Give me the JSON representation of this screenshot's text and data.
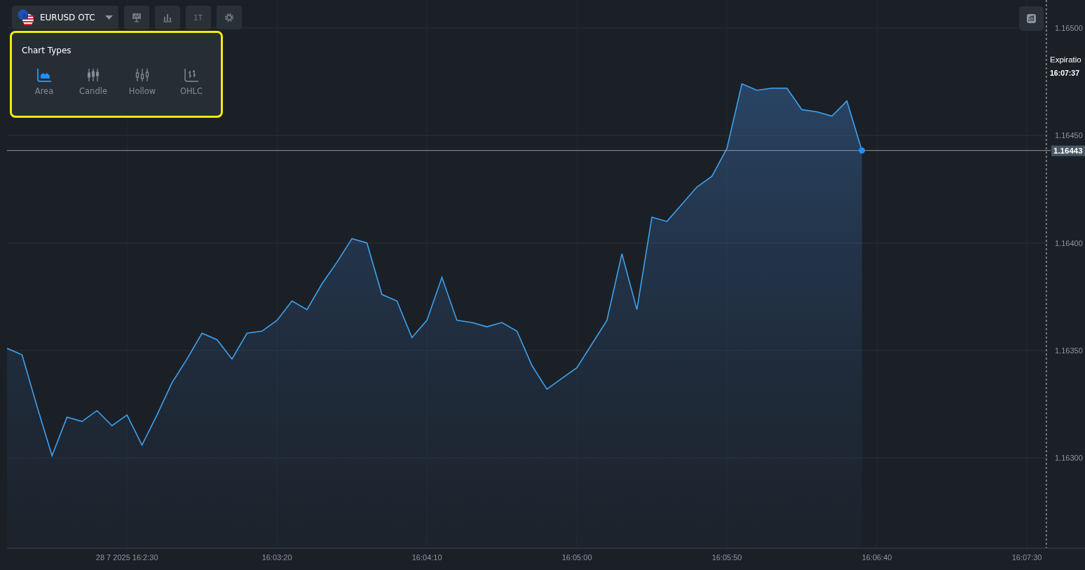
{
  "toolbar": {
    "asset": "EURUSD OTC",
    "buttons": [
      {
        "kind": "drawings"
      },
      {
        "kind": "indicators"
      },
      {
        "kind": "timeframe",
        "label": "1T"
      },
      {
        "kind": "settings"
      }
    ]
  },
  "chart_types": {
    "title": "Chart Types",
    "highlighted": true,
    "items": [
      {
        "kind": "area",
        "label": "Area",
        "selected": true
      },
      {
        "kind": "candle",
        "label": "Candle",
        "selected": false
      },
      {
        "kind": "hollow",
        "label": "Hollow",
        "selected": false
      },
      {
        "kind": "ohlc",
        "label": "OHLC",
        "selected": false
      }
    ]
  },
  "side_button": {
    "kind": "stats"
  },
  "expiration": {
    "label": "Expiratio",
    "time": "16:07:37"
  },
  "chart": {
    "chart_data": {
      "type": "area",
      "grid": true,
      "ref_lines": [
        {
          "axis": "y",
          "value": 1.16443,
          "label": "1.16443"
        }
      ],
      "categories": [
        null,
        null,
        null,
        null,
        null,
        null,
        null,
        null,
        "28 7 2025 16:2:30",
        null,
        null,
        null,
        null,
        null,
        null,
        null,
        null,
        null,
        "16:03:20",
        null,
        null,
        null,
        null,
        null,
        null,
        null,
        null,
        null,
        "16:04:10",
        null,
        null,
        null,
        null,
        null,
        null,
        null,
        null,
        null,
        "16:05:00",
        null,
        null,
        null,
        null,
        null,
        null,
        null,
        null,
        null,
        "16:05:50",
        null,
        null,
        null,
        null,
        null,
        null,
        null,
        null,
        null,
        "16:06:40",
        null,
        null,
        null,
        null,
        null,
        null,
        null,
        null,
        null,
        "16:07:30",
        null
      ],
      "series": [
        {
          "color": "#3fa2f0",
          "values": [
            1.16351,
            1.16348,
            1.16324,
            1.16301,
            1.16319,
            1.16317,
            1.16322,
            1.16315,
            1.1632,
            1.16306,
            1.1632,
            1.16335,
            1.16346,
            1.16358,
            1.16355,
            1.16346,
            1.16358,
            1.16359,
            1.16364,
            1.16373,
            1.16369,
            1.16381,
            1.16391,
            1.16402,
            1.164,
            1.16376,
            1.16373,
            1.16356,
            1.16364,
            1.16384,
            1.16364,
            1.16363,
            1.16361,
            1.16363,
            1.16359,
            1.16343,
            1.16332,
            1.16337,
            1.16342,
            1.16353,
            1.16364,
            1.16395,
            1.16369,
            1.16412,
            1.1641,
            1.16418,
            1.16426,
            1.16431,
            1.16444,
            1.16474,
            1.16471,
            1.16472,
            1.16472,
            1.16462,
            1.16461,
            1.16459,
            1.16466,
            1.16443,
            null,
            null,
            null,
            null,
            null,
            null,
            null,
            null,
            null,
            null,
            null,
            null
          ]
        }
      ],
      "ylim": [
        1.16258,
        1.16513
      ],
      "yticks": [
        {
          "value": 1.163,
          "label": "1.16300"
        },
        {
          "value": 1.1635,
          "label": "1.16350"
        },
        {
          "value": 1.164,
          "label": "1.16400"
        },
        {
          "value": 1.1645,
          "label": "1.16450"
        },
        {
          "value": 1.165,
          "label": "1.16500"
        }
      ]
    }
  }
}
